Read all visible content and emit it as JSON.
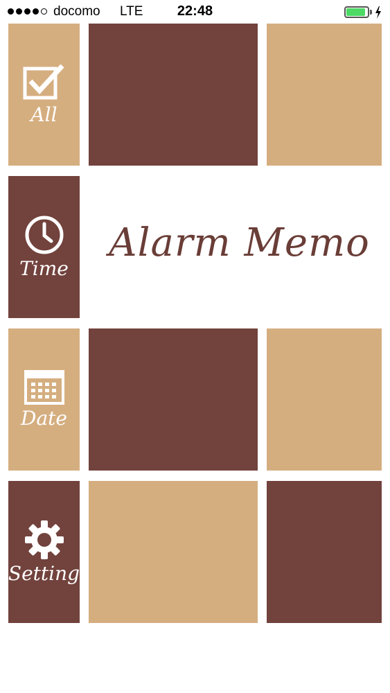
{
  "status_bar": {
    "carrier": "docomo",
    "network": "LTE",
    "time": "22:48",
    "signal_bars_filled": 4,
    "signal_bars_total": 5,
    "battery_level": 0.9,
    "charging": true
  },
  "app": {
    "title": "Alarm Memo"
  },
  "nav": {
    "all": {
      "label": "All",
      "icon": "checkbox-icon"
    },
    "time": {
      "label": "Time",
      "icon": "clock-icon"
    },
    "date": {
      "label": "Date",
      "icon": "calendar-icon"
    },
    "setting": {
      "label": "Setting",
      "icon": "gear-icon"
    }
  },
  "colors": {
    "tan": "#d5ae80",
    "brown": "#72423d",
    "title": "#6a3d37",
    "battery": "#4cd964"
  }
}
